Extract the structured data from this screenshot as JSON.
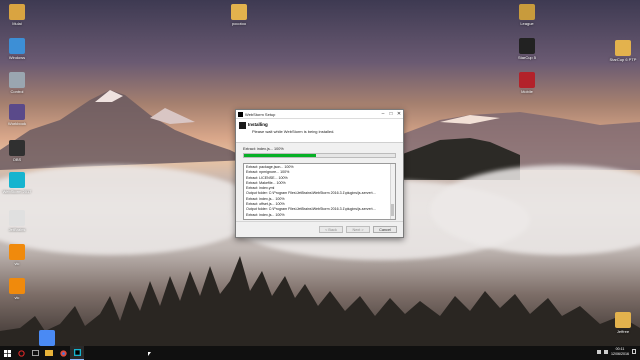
{
  "desktop": {
    "icons_left": [
      {
        "label": "Mulai",
        "icon": "user-folder-icon",
        "color": "#d9a441"
      },
      {
        "label": "Windows",
        "icon": "pc-icon",
        "color": "#3d8fd6"
      },
      {
        "label": "Control",
        "icon": "recycle-bin-icon",
        "color": "#9aa6b0"
      },
      {
        "label": "Workbook",
        "icon": "app-icon",
        "color": "#5a4a8a"
      },
      {
        "label": "OBS",
        "icon": "obs-icon",
        "color": "#303030"
      },
      {
        "label": "WebStorm 2017",
        "icon": "webstorm-icon",
        "color": "#16b4cf"
      },
      {
        "label": "JetBrains",
        "icon": "document-icon",
        "color": "#e0e0e0"
      },
      {
        "label": "vlc",
        "icon": "vlc-cone-icon",
        "color": "#f08a0c"
      },
      {
        "label": "vlc",
        "icon": "vlc-cone-icon",
        "color": "#f08a0c"
      },
      {
        "label": "",
        "icon": "chrome-icon",
        "color": "#4a8af4"
      }
    ],
    "icons_top": [
      {
        "label": "pocotoo",
        "icon": "folder-icon",
        "color": "#e3b24d"
      }
    ],
    "icons_right": [
      {
        "label": "League",
        "icon": "league-icon",
        "color": "#c89b3c"
      },
      {
        "label": "StarCup 5",
        "icon": "game-5-icon",
        "color": "#222222"
      },
      {
        "label": "Mobile",
        "icon": "game-icon",
        "color": "#b3222a"
      },
      {
        "label": "StarCup 6 PTP",
        "icon": "folder-icon",
        "color": "#e3b24d"
      },
      {
        "label": "Jeffree",
        "icon": "folder-icon",
        "color": "#e3b24d"
      }
    ]
  },
  "installer": {
    "window_title": "WebStorm Setup",
    "header_title": "Installing",
    "header_subtitle": "Please wait while WebStorm is being installed.",
    "status_text": "Extract: index.js... 100%",
    "progress_percent": 48,
    "log_lines": [
      "Extract: package.json... 100%",
      "Extract: npmignore... 100%",
      "Extract: LICENSE... 100%",
      "Extract: Makefile... 100%",
      "Extract: index.yml",
      "Output folder: C:\\Program Files\\JetBrains\\WebStorm 2016.3.1\\plugins\\js-server\\...",
      "Extract: index.js... 100%",
      "Extract: offset.js... 100%",
      "Output folder: C:\\Program Files\\JetBrains\\WebStorm 2016.3.1\\plugins\\js-server\\...",
      "Extract: index.js... 100%"
    ],
    "buttons": {
      "back": "< Back",
      "next": "Next >",
      "cancel": "Cancel"
    }
  },
  "taskbar": {
    "clock_time": "00:11",
    "clock_date": "12/06/2016"
  },
  "colors": {
    "progress": "#06b025",
    "taskbar": "#101010"
  }
}
